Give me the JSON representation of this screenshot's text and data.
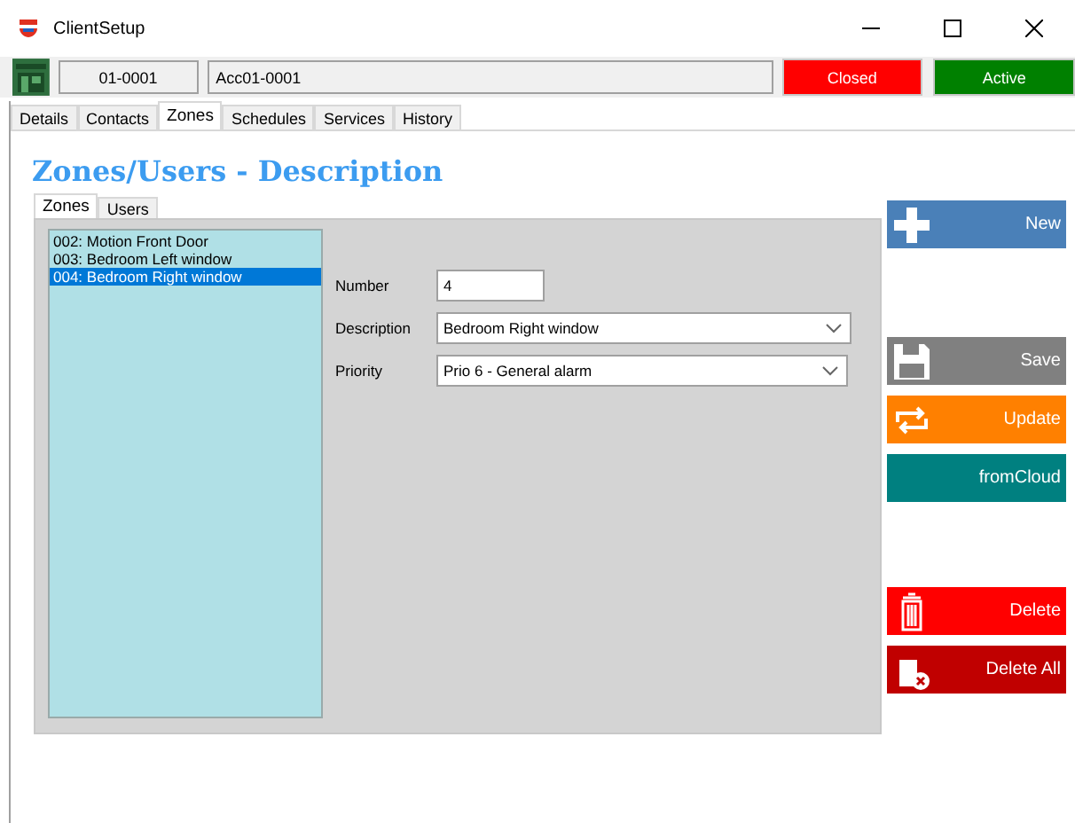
{
  "window": {
    "title": "ClientSetup"
  },
  "toolbar": {
    "code": "01-0001",
    "account": "Acc01-0001",
    "status_buttons": [
      {
        "label": "Closed",
        "kind": "closed"
      },
      {
        "label": "Active",
        "kind": "active"
      }
    ]
  },
  "tabs": [
    {
      "label": "Details",
      "selected": false
    },
    {
      "label": "Contacts",
      "selected": false
    },
    {
      "label": "Zones",
      "selected": true
    },
    {
      "label": "Schedules",
      "selected": false
    },
    {
      "label": "Services",
      "selected": false
    },
    {
      "label": "History",
      "selected": false
    }
  ],
  "heading": "Zones/Users - Description",
  "sub_tabs": [
    {
      "label": "Zones",
      "selected": true
    },
    {
      "label": "Users",
      "selected": false
    }
  ],
  "zones": [
    {
      "label": "002: Motion Front Door",
      "selected": false
    },
    {
      "label": "003: Bedroom Left window",
      "selected": false
    },
    {
      "label": "004: Bedroom Right window",
      "selected": true
    }
  ],
  "form": {
    "number": {
      "label": "Number",
      "value": "4"
    },
    "description": {
      "label": "Description",
      "value": "Bedroom Right window"
    },
    "priority": {
      "label": "Priority",
      "value": "Prio 6 - General alarm"
    }
  },
  "buttons": [
    {
      "label": "New",
      "kind": "new"
    },
    {
      "label": "Save",
      "kind": "save"
    },
    {
      "label": "Update",
      "kind": "update"
    },
    {
      "label": "fromCloud",
      "kind": "cloud"
    },
    {
      "label": "Delete",
      "kind": "delete"
    },
    {
      "label": "Delete All",
      "kind": "delete_all"
    }
  ]
}
